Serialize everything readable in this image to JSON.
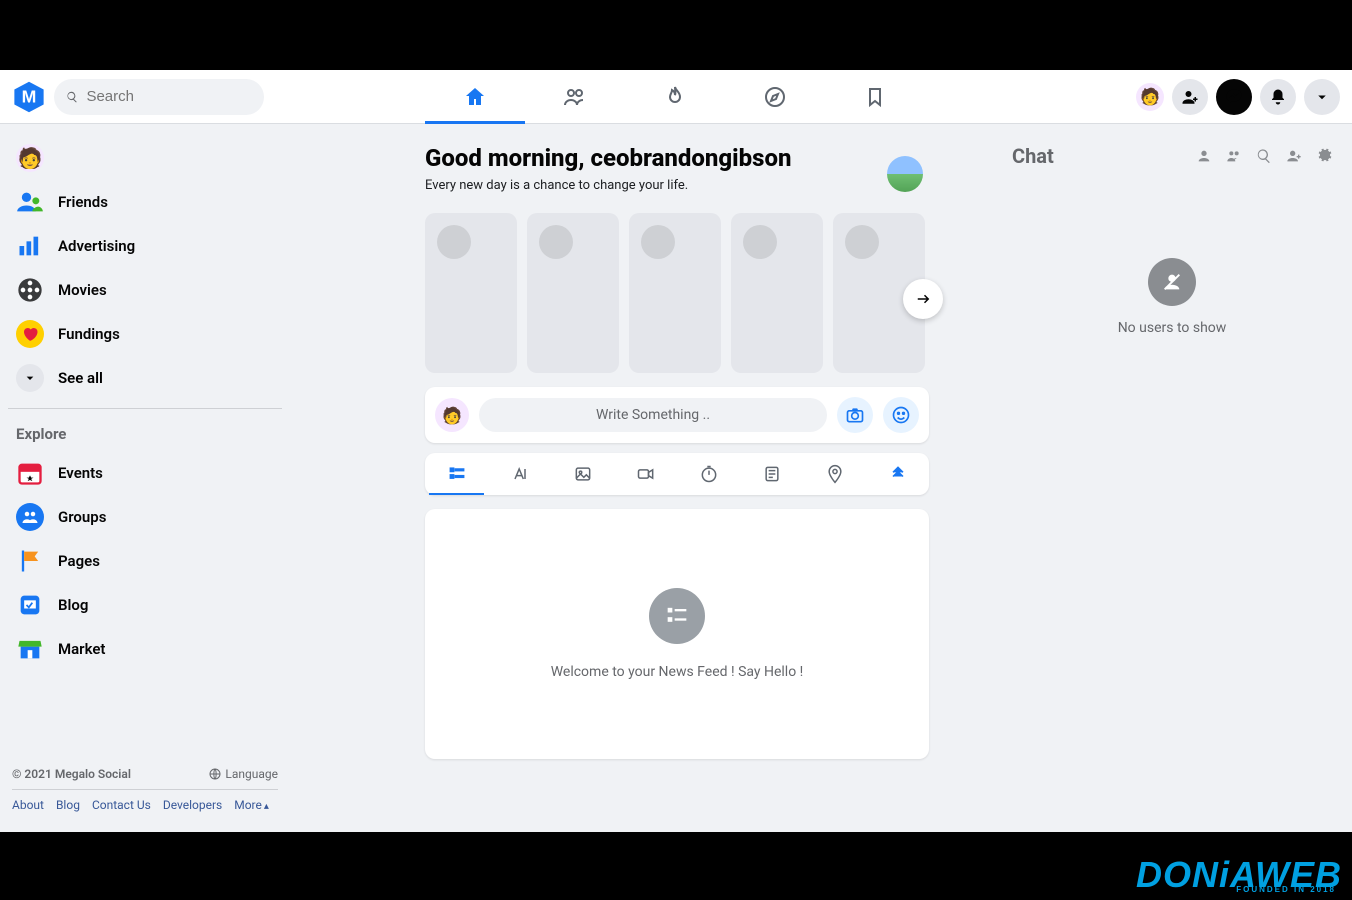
{
  "header": {
    "search_placeholder": "Search"
  },
  "sidebar": {
    "items": [
      {
        "label": "",
        "icon": "avatar"
      },
      {
        "label": "Friends",
        "icon": "friends"
      },
      {
        "label": "Advertising",
        "icon": "chart"
      },
      {
        "label": "Movies",
        "icon": "movie"
      },
      {
        "label": "Fundings",
        "icon": "heart"
      }
    ],
    "see_all": "See all",
    "explore_title": "Explore",
    "explore": [
      {
        "label": "Events",
        "icon": "events"
      },
      {
        "label": "Groups",
        "icon": "groups"
      },
      {
        "label": "Pages",
        "icon": "pages"
      },
      {
        "label": "Blog",
        "icon": "blog"
      },
      {
        "label": "Market",
        "icon": "market"
      }
    ]
  },
  "footer": {
    "copyright": "© 2021 Megalo Social",
    "language": "Language",
    "links": [
      "About",
      "Blog",
      "Contact Us",
      "Developers",
      "More"
    ]
  },
  "main": {
    "greeting": "Good morning, ceobrandongibson",
    "subtext": "Every new day is a chance to change your life.",
    "composer_placeholder": "Write Something ..",
    "feed_empty": "Welcome to your News Feed ! Say Hello !"
  },
  "chat": {
    "title": "Chat",
    "empty": "No users to show"
  },
  "watermark": {
    "text": "DONiAWEB",
    "sub": "FOUNDED IN 2018"
  }
}
